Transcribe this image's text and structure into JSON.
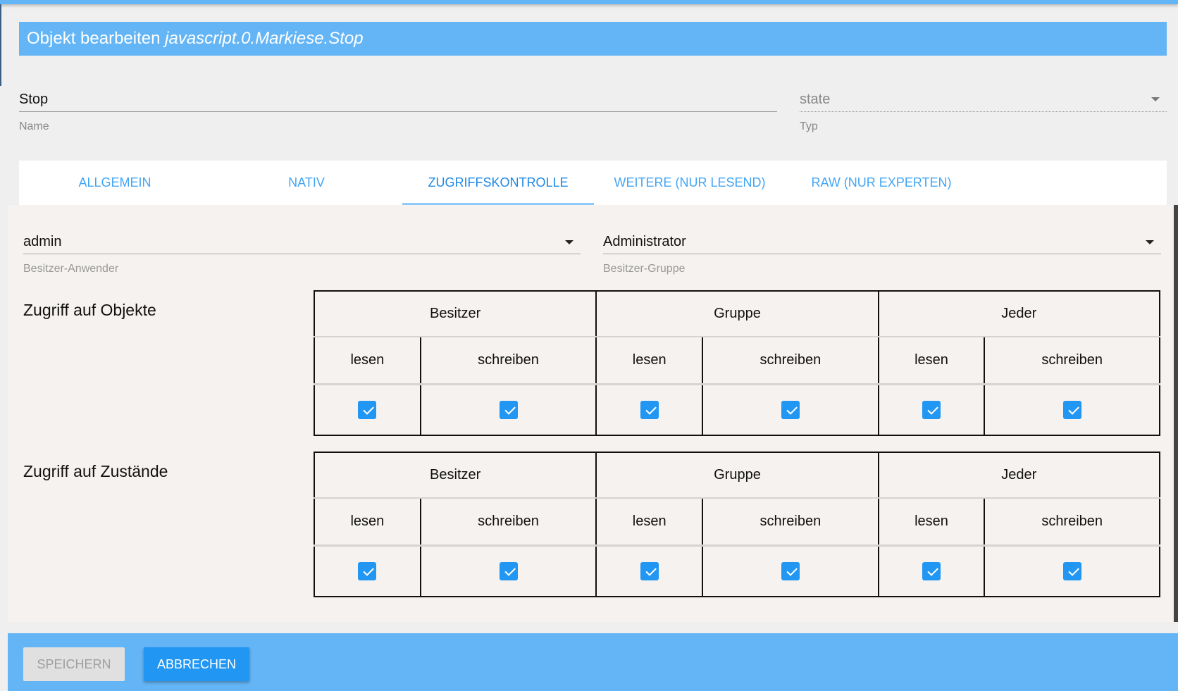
{
  "dialog": {
    "title_prefix": "Objekt bearbeiten",
    "object_id": "javascript.0.Markiese.Stop"
  },
  "name_field": {
    "value": "Stop",
    "label": "Name"
  },
  "type_field": {
    "value": "state",
    "label": "Typ"
  },
  "tabs": [
    {
      "label": "ALLGEMEIN"
    },
    {
      "label": "NATIV"
    },
    {
      "label": "ZUGRIFFSKONTROLLE",
      "active": true
    },
    {
      "label": "WEITERE (NUR LESEND)"
    },
    {
      "label": "RAW (NUR EXPERTEN)"
    }
  ],
  "owner_user": {
    "value": "admin",
    "label": "Besitzer-Anwender"
  },
  "owner_group": {
    "value": "Administrator",
    "label": "Besitzer-Gruppe"
  },
  "groups": [
    "Besitzer",
    "Gruppe",
    "Jeder"
  ],
  "perms": [
    "lesen",
    "schreiben"
  ],
  "sections": [
    {
      "title": "Zugriff auf Objekte",
      "checked": [
        true,
        true,
        true,
        true,
        true,
        true
      ]
    },
    {
      "title": "Zugriff auf Zustände",
      "checked": [
        true,
        true,
        true,
        true,
        true,
        true
      ]
    }
  ],
  "footer": {
    "save_label": "SPEICHERN",
    "cancel_label": "ABBRECHEN"
  },
  "colors": {
    "accent": "#64b5f6",
    "checkbox": "#2196f3"
  }
}
